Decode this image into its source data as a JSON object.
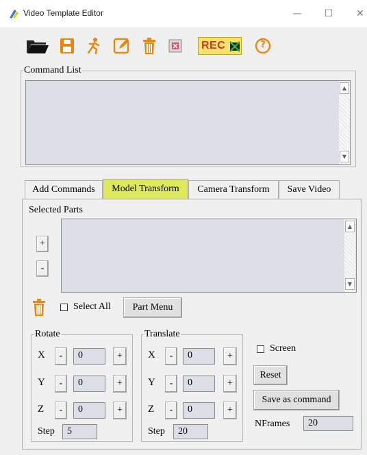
{
  "window": {
    "title": "Video Template Editor",
    "minimize_glyph": "—",
    "maximize_glyph": "☐",
    "close_glyph": "✕"
  },
  "toolbar": {
    "rec_label": "REC",
    "help_glyph": "?",
    "icons": [
      "folder-open-icon",
      "save-icon",
      "run-icon",
      "edit-icon",
      "trash-icon",
      "delete-icon",
      "rec-off-icon",
      "help-icon"
    ]
  },
  "command_list": {
    "label": "Command List"
  },
  "tabs": [
    "Add Commands",
    "Model Transform",
    "Camera Transform",
    "Save Video"
  ],
  "active_tab": 1,
  "selected_parts": {
    "label": "Selected Parts",
    "add_label": "+",
    "remove_label": "-",
    "select_all_label": "Select All",
    "select_all_checked": false,
    "part_menu_label": "Part Menu"
  },
  "rotate": {
    "label": "Rotate",
    "rows": [
      {
        "axis": "X",
        "minus": "-",
        "value": "0",
        "plus": "+"
      },
      {
        "axis": "Y",
        "minus": "-",
        "value": "0",
        "plus": "+"
      },
      {
        "axis": "Z",
        "minus": "-",
        "value": "0",
        "plus": "+"
      }
    ],
    "step_label": "Step",
    "step_value": "5"
  },
  "translate": {
    "label": "Translate",
    "rows": [
      {
        "axis": "X",
        "minus": "-",
        "value": "0",
        "plus": "+"
      },
      {
        "axis": "Y",
        "minus": "-",
        "value": "0",
        "plus": "+"
      },
      {
        "axis": "Z",
        "minus": "-",
        "value": "0",
        "plus": "+"
      }
    ],
    "step_label": "Step",
    "step_value": "20"
  },
  "options": {
    "screen_label": "Screen",
    "screen_checked": false,
    "reset_label": "Reset",
    "save_as_command_label": "Save as command",
    "nframes_label": "NFrames",
    "nframes_value": "20"
  },
  "colors": {
    "active_tab": "#dde85a",
    "listbox": "#dcdfe6",
    "window_bg": "#f0f0f0",
    "trash_orange": "#e07a10"
  }
}
